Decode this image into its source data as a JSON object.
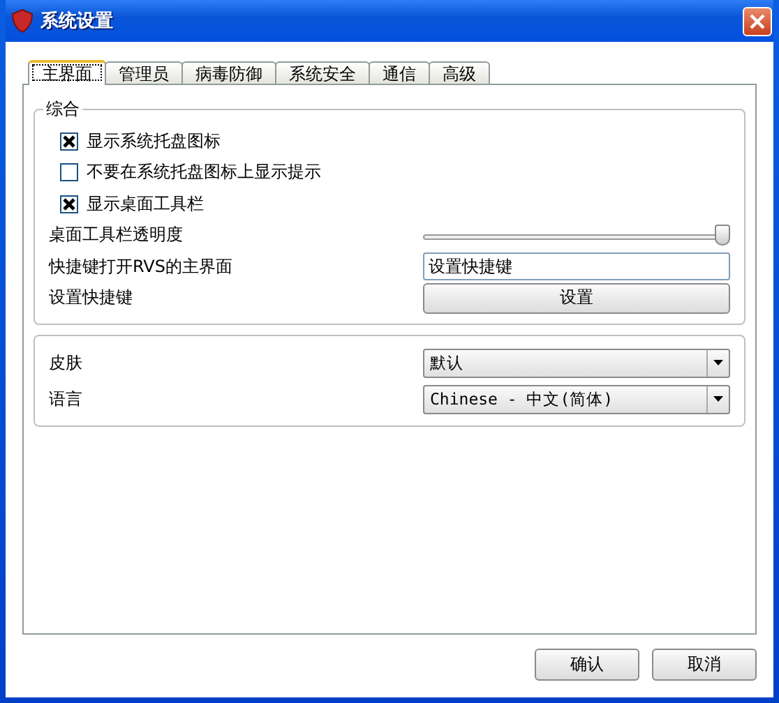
{
  "window": {
    "title": "系统设置"
  },
  "tabs": [
    {
      "label": "主界面",
      "selected": true
    },
    {
      "label": "管理员",
      "selected": false
    },
    {
      "label": "病毒防御",
      "selected": false
    },
    {
      "label": "系统安全",
      "selected": false
    },
    {
      "label": "通信",
      "selected": false
    },
    {
      "label": "高级",
      "selected": false
    }
  ],
  "general": {
    "title": "综合",
    "rows": [
      {
        "kind": "checkbox",
        "label": "显示系统托盘图标",
        "checked": true
      },
      {
        "kind": "checkbox",
        "label": "不要在系统托盘图标上显示提示",
        "checked": false
      },
      {
        "kind": "checkbox",
        "label": "显示桌面工具栏",
        "checked": true
      },
      {
        "kind": "slider",
        "label": "桌面工具栏透明度",
        "level": 1
      },
      {
        "kind": "input",
        "label": "快捷键打开RVS的主界面",
        "value": "设置快捷键"
      },
      {
        "kind": "button",
        "label": "设置快捷键",
        "button": "设置"
      }
    ]
  },
  "appearance": [
    {
      "label": "皮肤",
      "value": "默认"
    },
    {
      "label": "语言",
      "value": "Chinese - 中文(简体)"
    }
  ],
  "buttons": [
    "确认",
    "取消"
  ]
}
